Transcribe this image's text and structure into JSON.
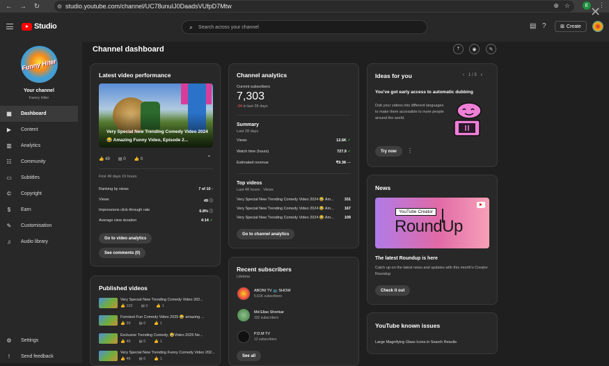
{
  "browser": {
    "url": "studio.youtube.com/channel/UC78unuIJ0DaadsVUfpD7Mtw",
    "profile_letter": "E"
  },
  "topbar": {
    "logo": "Studio",
    "search_placeholder": "Search across your channel",
    "create_label": "Create"
  },
  "sidebar": {
    "avatar_text": "Funny Hiter",
    "channel_label": "Your channel",
    "channel_name": "Fanny Hiter",
    "items": [
      {
        "label": "Dashboard",
        "icon": "dashboard-icon"
      },
      {
        "label": "Content",
        "icon": "content-icon"
      },
      {
        "label": "Analytics",
        "icon": "analytics-icon"
      },
      {
        "label": "Community",
        "icon": "community-icon"
      },
      {
        "label": "Subtitles",
        "icon": "subtitles-icon"
      },
      {
        "label": "Copyright",
        "icon": "copyright-icon"
      },
      {
        "label": "Earn",
        "icon": "earn-icon"
      },
      {
        "label": "Customisation",
        "icon": "customisation-icon"
      },
      {
        "label": "Audio library",
        "icon": "audio-library-icon"
      }
    ],
    "bottom": [
      {
        "label": "Settings",
        "icon": "settings-icon"
      },
      {
        "label": "Send feedback",
        "icon": "feedback-icon"
      }
    ]
  },
  "page": {
    "title": "Channel dashboard"
  },
  "latest": {
    "title": "Latest video performance",
    "thumb_title": "Very Special New Trending Comedy Video 2024 😂 Amazing Funny Video, Episode 2...",
    "likes": "49",
    "dislikes": "0",
    "comments": "0",
    "period": "First 49 days 19 hours",
    "rows": [
      {
        "label": "Ranking by views",
        "value": "7 of 10"
      },
      {
        "label": "Views",
        "value": "49"
      },
      {
        "label": "Impressions click-through rate",
        "value": "6.8%"
      },
      {
        "label": "Average view duration",
        "value": "4:14"
      }
    ],
    "btn_analytics": "Go to video analytics",
    "btn_comments": "See comments (0)"
  },
  "analytics": {
    "title": "Channel analytics",
    "subs_label": "Current subscribers",
    "subs_value": "7,303",
    "subs_change": "-34",
    "subs_change_suffix": " in last 28 days",
    "summary_title": "Summary",
    "summary_period": "Last 28 days",
    "summary": [
      {
        "label": "Views",
        "value": "12.6K"
      },
      {
        "label": "Watch time (hours)",
        "value": "727.9"
      },
      {
        "label": "Estimated revenue",
        "value": "₹9.38"
      }
    ],
    "top_title": "Top videos",
    "top_period": "Last 48 hours · Views",
    "top": [
      {
        "label": "Very Special New Trending Comedy Video 2024 😂 Am...",
        "value": "331"
      },
      {
        "label": "Very Special New Trending Comedy Video 2024 😂 Am...",
        "value": "167"
      },
      {
        "label": "Very Special New Trending Comedy Video 2024 😂 Am...",
        "value": "109"
      }
    ],
    "btn": "Go to channel analytics"
  },
  "published": {
    "title": "Published videos",
    "items": [
      {
        "title": "Very Special New Trending Comedy Video 202...",
        "views": "102",
        "comments": "0",
        "likes": "1"
      },
      {
        "title": "Funniest Fun Comedy Video 2025 😂 amazing ...",
        "views": "39",
        "comments": "0",
        "likes": "1"
      },
      {
        "title": "Exclusive Trending Comedy, 😂Video 2025 Ne...",
        "views": "49",
        "comments": "0",
        "likes": "1"
      },
      {
        "title": "Very Special New Trending Funny Comedy Video 202...",
        "views": "46",
        "comments": "0",
        "likes": "1"
      }
    ]
  },
  "recent": {
    "title": "Recent subscribers",
    "period": "Lifetime",
    "items": [
      {
        "name": "ABONI TV 📺 SHOW",
        "subs": "5.61K subscribers"
      },
      {
        "name": "Md Elias Shonkar",
        "subs": "332 subscribers"
      },
      {
        "name": "P.D.M TV",
        "subs": "12 subscribers"
      }
    ],
    "btn": "See all"
  },
  "ideas": {
    "title": "Ideas for you",
    "pager": "1 / 3",
    "headline": "You've got early access to automatic dubbing",
    "body": "Dub your videos into different languages to make them accessible to more people around the world.",
    "btn": "Try now"
  },
  "news": {
    "title": "News",
    "img_label": "YouTube Creator",
    "img_big": "RoundUp",
    "headline": "The latest Roundup is here",
    "body": "Catch up on the latest news and updates with this month's Creator Roundup",
    "btn": "Check it out"
  },
  "known": {
    "title": "YouTube known issues",
    "item": "Large Magnifying Glass Icons in Search Results"
  }
}
